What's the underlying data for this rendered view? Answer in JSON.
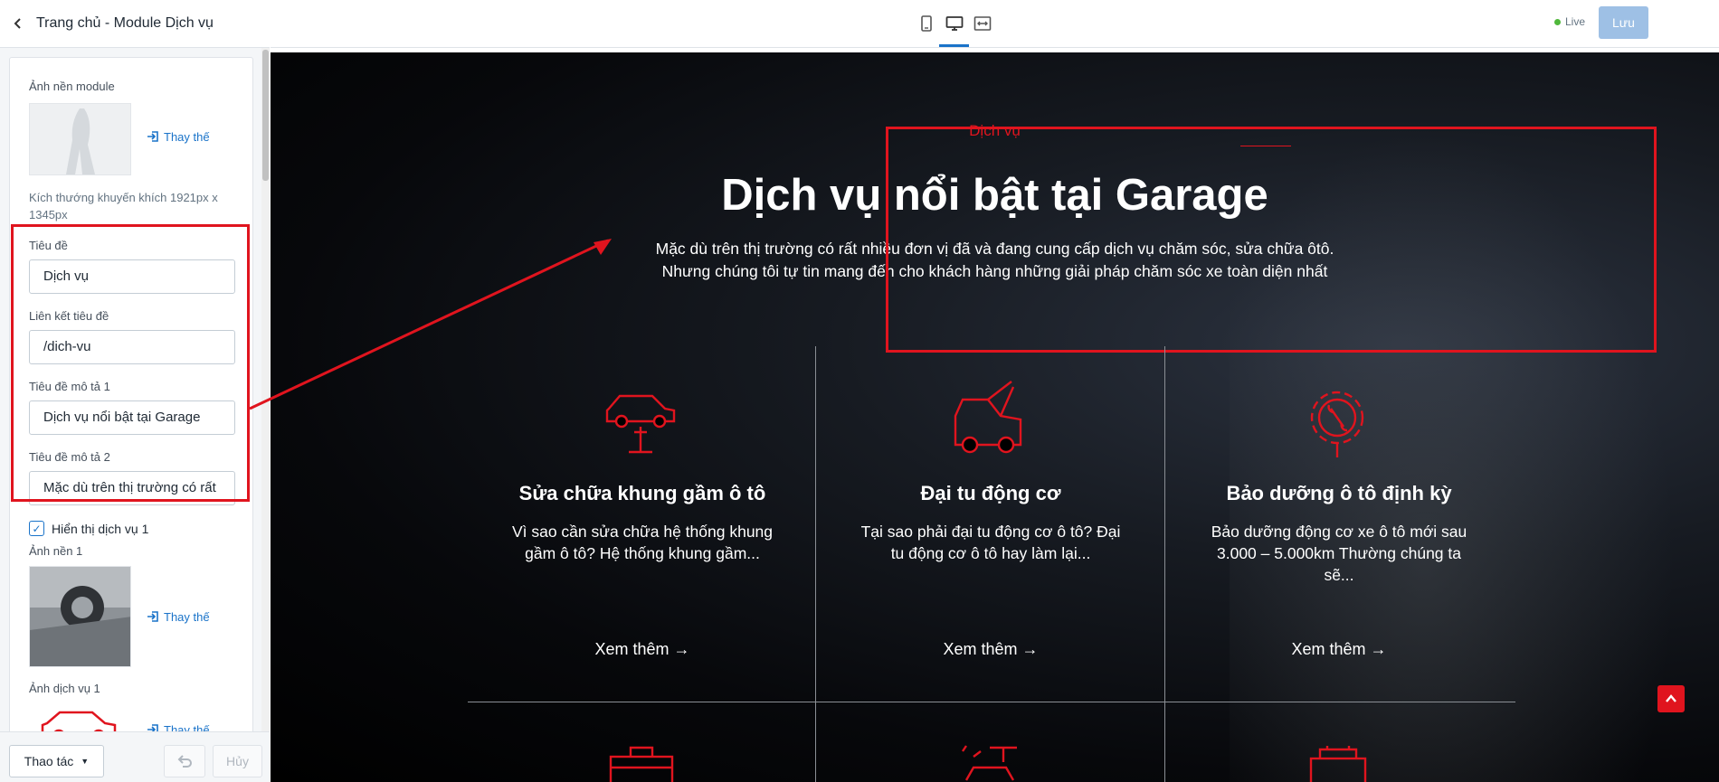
{
  "sidebar": {
    "header_title": "Trang chủ - Module Dịch vụ",
    "bg_label": "Ảnh nền module",
    "replace_label": "Thay thế",
    "size_hint": "Kích thướng khuyến khích 1921px x 1345px",
    "title_label": "Tiêu đề",
    "title_value": "Dịch vụ",
    "link_label": "Liên kết tiêu đề",
    "link_value": "/dich-vu",
    "desc1_label": "Tiêu đề mô tả 1",
    "desc1_value": "Dịch vụ nổi bật tại Garage",
    "desc2_label": "Tiêu đề mô tả 2",
    "desc2_value": "Mặc dù trên thị trường có rất",
    "show_service_label": "Hiển thị dịch vụ 1",
    "bg1_label": "Ảnh nền 1",
    "service_img_label": "Ảnh dịch vụ 1",
    "actions_label": "Thao tác",
    "cancel_label": "Hủy"
  },
  "topbar": {
    "live_label": "Live",
    "save_label": "Lưu"
  },
  "preview": {
    "eyebrow": "Dịch vụ",
    "title": "Dịch vụ nổi bật tại Garage",
    "desc_line1": "Mặc dù trên thị trường có rất nhiều đơn vị đã và đang cung cấp dịch vụ chăm sóc, sửa chữa ôtô.",
    "desc_line2": "Nhưng chúng tôi tự tin mang đến cho khách hàng những giải pháp chăm sóc xe toàn diện nhất",
    "services": [
      {
        "title": "Sửa chữa khung gầm ô tô",
        "desc": "Vì sao cần sửa chữa hệ thống khung gầm ô tô? Hệ thống khung gầm...",
        "more": "Xem thêm →",
        "icon": "car-lift-icon"
      },
      {
        "title": "Đại tu động cơ",
        "desc": "Tại sao phải đại tu động cơ ô tô? Đại tu động cơ ô tô hay làm lại...",
        "more": "Xem thêm →",
        "icon": "engine-hood-icon"
      },
      {
        "title": "Bảo dưỡng ô tô định kỳ",
        "desc": "Bảo dưỡng động cơ xe ô tô mới sau 3.000 – 5.000km Thường chúng ta sẽ...",
        "more": "Xem thêm →",
        "icon": "gear-wrench-icon"
      }
    ]
  },
  "colors": {
    "accent_red": "#e0141e",
    "primary_blue": "#1a73c9",
    "save_disabled": "#9ec0e5"
  }
}
